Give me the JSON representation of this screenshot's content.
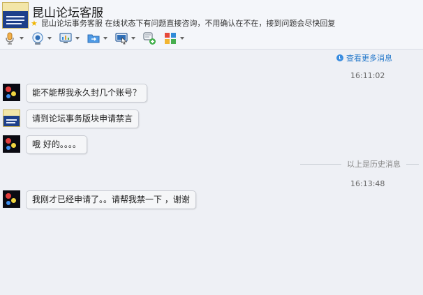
{
  "header": {
    "title": "昆山论坛客服",
    "subtitle": "昆山论坛事务客服 在线状态下有问题直接咨询，不用确认在不在，接到问题会尽快回复"
  },
  "toolbar": {
    "buttons": [
      {
        "icon": "microphone-icon"
      },
      {
        "icon": "camera-icon"
      },
      {
        "icon": "screen-share-icon"
      },
      {
        "icon": "file-transfer-icon"
      },
      {
        "icon": "remote-assist-icon"
      },
      {
        "icon": "invite-chat-icon"
      },
      {
        "icon": "apps-icon"
      }
    ]
  },
  "chat": {
    "view_more": "查看更多消息",
    "history_divider": "以上是历史消息",
    "timestamps": [
      "16:11:02",
      "16:13:48"
    ],
    "messages": [
      {
        "sender": "user",
        "text": "能不能帮我永久封几个账号？"
      },
      {
        "sender": "service",
        "text": "请到论坛事务版块申请禁言"
      },
      {
        "sender": "user",
        "text": "哦 好的。。。。"
      },
      {
        "sender": "user",
        "text": "我刚才已经申请了。。请帮我禁一下 ，谢谢"
      }
    ]
  },
  "colors": {
    "background": "#eef0f5",
    "link": "#1f75c9",
    "star": "#f0b400"
  }
}
